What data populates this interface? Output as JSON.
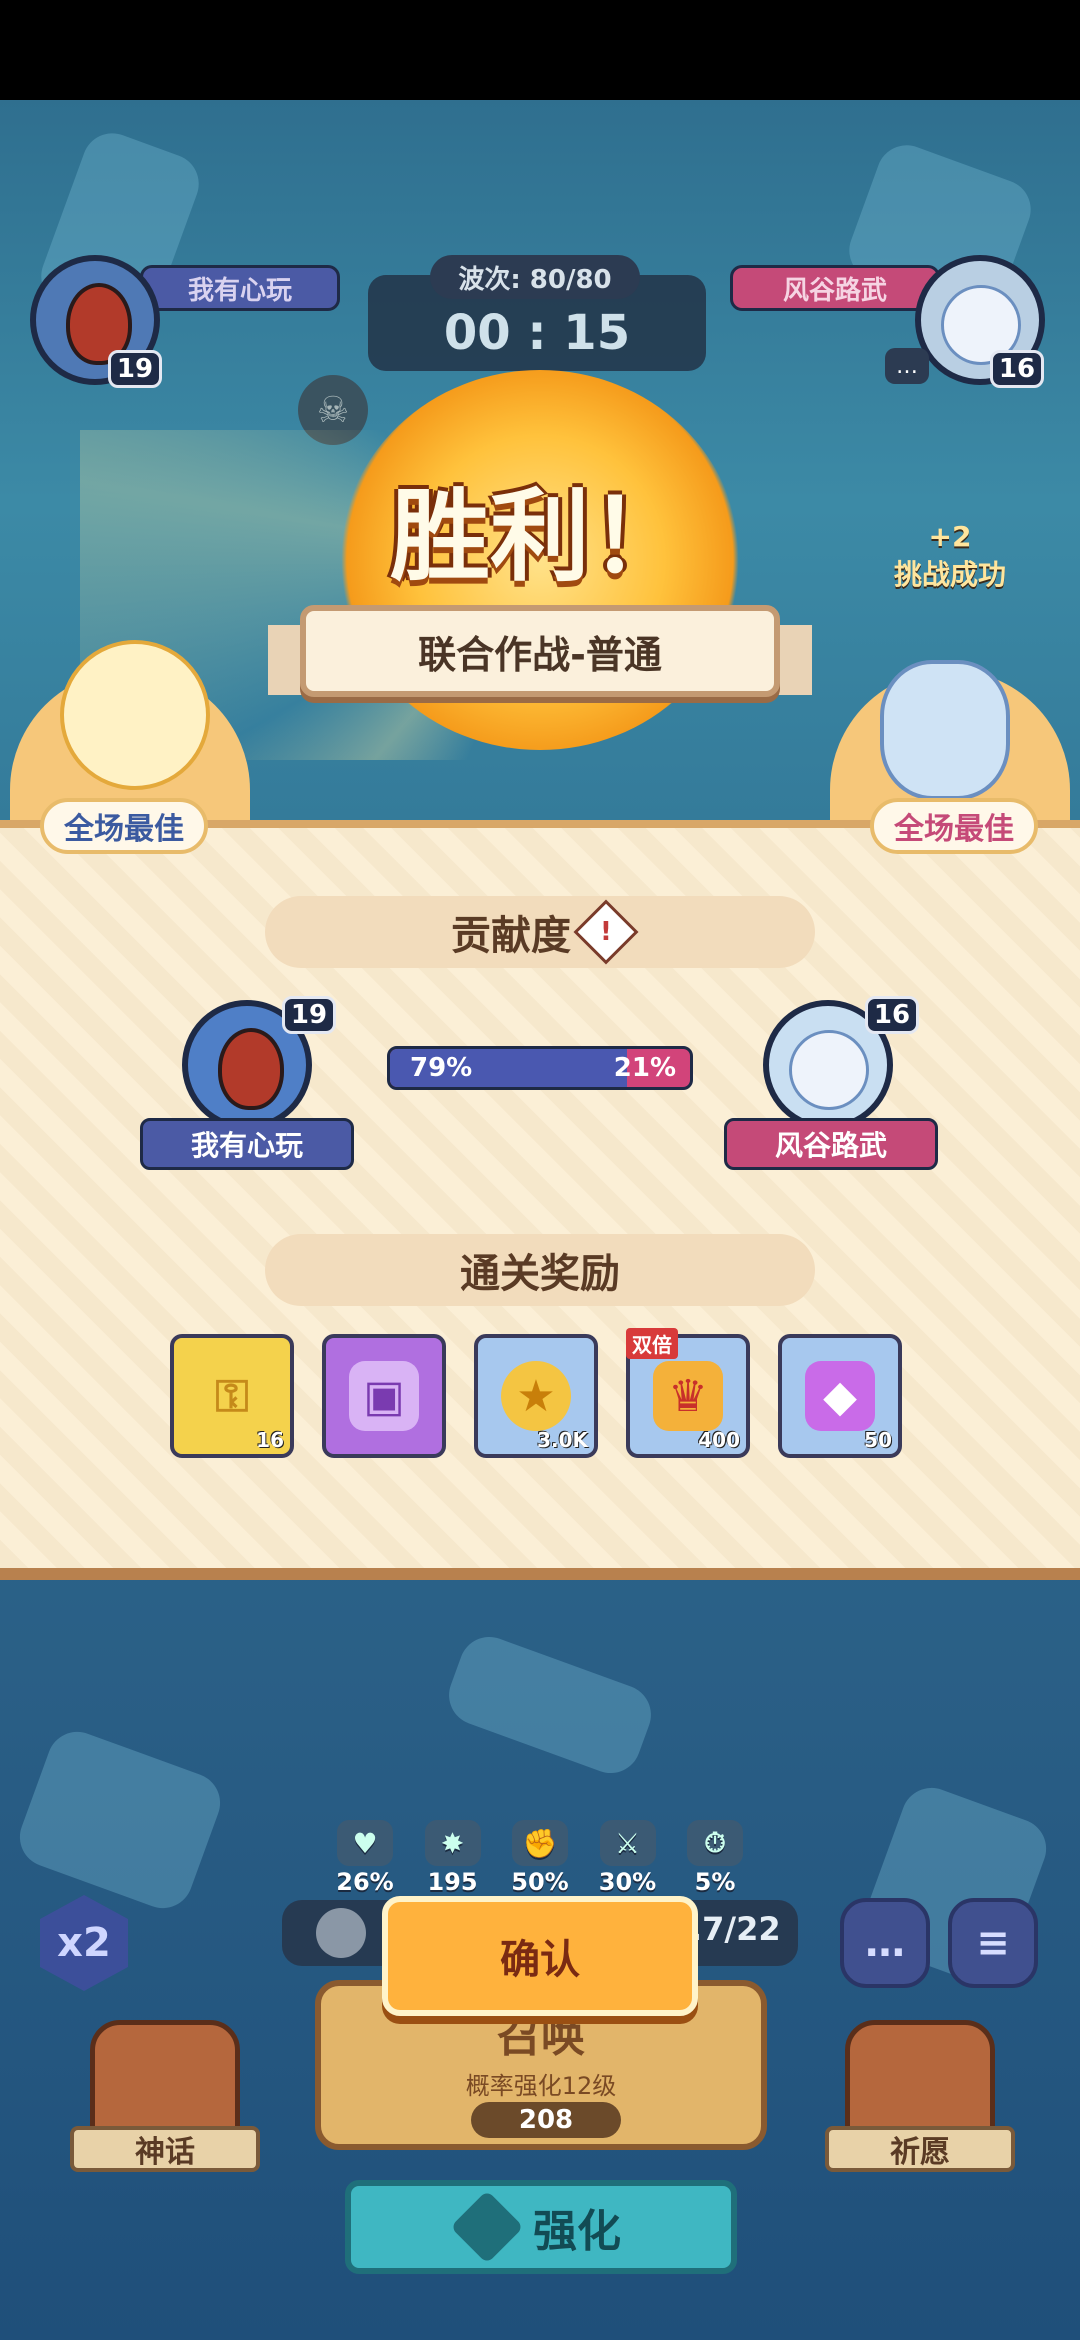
{
  "hud": {
    "player_left": {
      "name": "我有心玩",
      "level": "19"
    },
    "player_right": {
      "name": "风谷路武",
      "level": "16"
    },
    "wave": "波次: 80/80",
    "timer": "00 : 15"
  },
  "victory": {
    "title": "胜利！",
    "mode": "联合作战-普通",
    "mvp_label": "全场最佳",
    "challenge_bonus": "+2",
    "challenge_text": "挑战成功"
  },
  "contribution": {
    "title": "贡献度",
    "left": {
      "name": "我有心玩",
      "level": "19",
      "percent_label": "79%",
      "share": 0.79
    },
    "right": {
      "name": "风谷路武",
      "level": "16",
      "percent_label": "21%",
      "share": 0.21
    }
  },
  "rewards": {
    "title": "通关奖励",
    "items": [
      {
        "icon": "key-icon",
        "qty": "16",
        "tag": ""
      },
      {
        "icon": "chest-icon",
        "qty": "",
        "tag": ""
      },
      {
        "icon": "coin-icon",
        "qty": "3.0K",
        "tag": ""
      },
      {
        "icon": "trophy-icon",
        "qty": "400",
        "tag": "双倍"
      },
      {
        "icon": "crystal-icon",
        "qty": "50",
        "tag": ""
      }
    ]
  },
  "stats": [
    {
      "icon": "heart-icon",
      "value": "26%"
    },
    {
      "icon": "crit-icon",
      "value": "195"
    },
    {
      "icon": "fist-icon",
      "value": "50%"
    },
    {
      "icon": "sword-icon",
      "value": "30%"
    },
    {
      "icon": "speed-icon",
      "value": "5%"
    }
  ],
  "controls": {
    "confirm": "确认",
    "speed": "x2",
    "summon_title": "召唤",
    "summon_sub": "概率强化12级",
    "summon_cost": "208",
    "unit_count": ".7/22",
    "myth": "神话",
    "wish": "祈愿",
    "upgrade": "强化"
  }
}
